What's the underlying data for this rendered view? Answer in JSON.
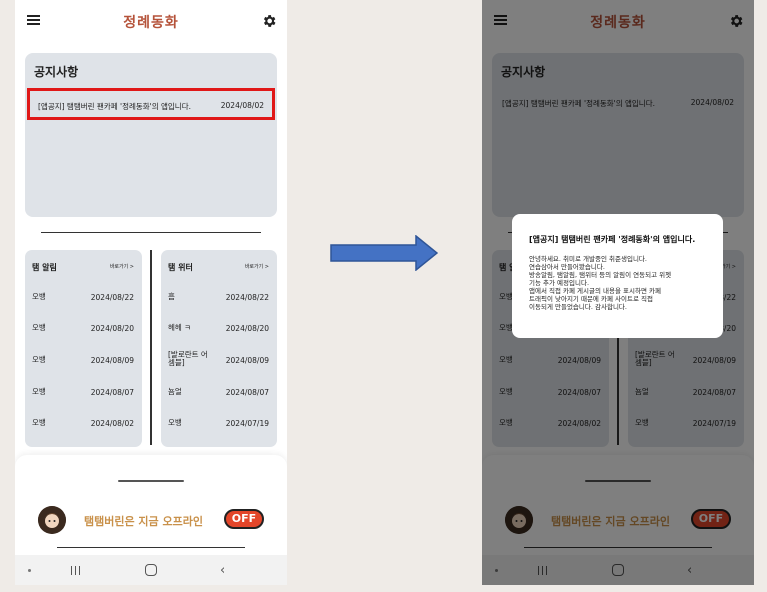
{
  "app": {
    "title": "정례동화"
  },
  "notice": {
    "heading": "공지사항",
    "items": [
      {
        "text": "[앱공지] 탬탬버린 팬카페 '정례동화'의 앱입니다.",
        "date": "2024/08/02"
      }
    ]
  },
  "tam_alerts": {
    "title": "탬 알림",
    "link": "바로가기 >",
    "rows": [
      {
        "name": "오뱅",
        "date": "2024/08/22"
      },
      {
        "name": "오뱅",
        "date": "2024/08/20"
      },
      {
        "name": "오뱅",
        "date": "2024/08/09"
      },
      {
        "name": "오뱅",
        "date": "2024/08/07"
      },
      {
        "name": "오뱅",
        "date": "2024/08/02"
      }
    ]
  },
  "tam_twitter": {
    "title": "탬 위터",
    "link": "바로가기 >",
    "rows": [
      {
        "name": "흠",
        "date": "2024/08/22"
      },
      {
        "name": "헤헤 ㅋ",
        "date": "2024/08/20"
      },
      {
        "name": "[발로란트 어셈블]",
        "date": "2024/08/09"
      },
      {
        "name": "뇸얼",
        "date": "2024/08/07"
      },
      {
        "name": "오뱅",
        "date": "2024/07/19"
      }
    ]
  },
  "status": {
    "text": "탬탬버린은 지금 오프라인",
    "badge": "OFF"
  },
  "dialog": {
    "title": "[앱공지] 탬탬버린 팬카페 '정례동화'의 앱입니다.",
    "body_lines": [
      "안녕하세요. 취미로 개발중인 취준생입니다.",
      "연습삼아서 만들어봤습니다.",
      "방송알림, 탬알림, 탬위터 등의 알림이 연동되고 위젯",
      "기능 추가 예정입니다.",
      "앱에서 직접 카페 게시글의 내용을 표시하면 카페",
      "트래픽이 낮아지기 때문에 카페 사이트로 직접",
      "이동되게 만들었습니다. 감사합니다."
    ]
  },
  "colors": {
    "title": "#b5533a",
    "card": "#dfe3e8",
    "highlight": "#e01818",
    "offline_text": "#c9914a",
    "off_badge": "#e3462a",
    "arrow": "#4472c4"
  },
  "icons": {
    "menu": "hamburger-menu-icon",
    "settings": "gear-icon",
    "arrow": "right-arrow-icon",
    "nav": [
      "nav-dot-icon",
      "recent-apps-icon",
      "home-icon",
      "back-icon"
    ]
  }
}
